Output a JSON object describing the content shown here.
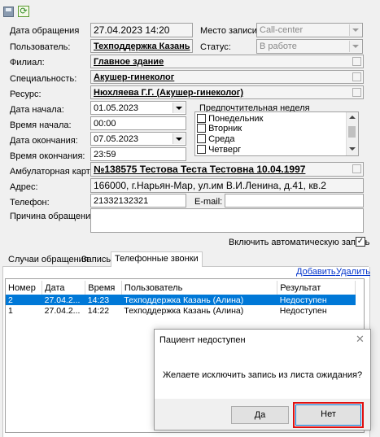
{
  "toolbar": {
    "save_icon": "save-icon",
    "refresh_icon": "refresh-icon"
  },
  "form": {
    "date_label": "Дата обращения",
    "date_value": "27.04.2023 14:20",
    "place_label": "Место записи:",
    "place_value": "Call-center",
    "user_label": "Пользователь:",
    "user_value": "Техподдержка Казань",
    "status_label": "Статус:",
    "status_value": "В работе",
    "branch_label": "Филиал:",
    "branch_value": "Главное здание",
    "spec_label": "Специальность:",
    "spec_value": "Акушер-гинеколог",
    "resource_label": "Ресурс:",
    "resource_value": "Нюхляева Г.Г. (Акушер-гинеколог)",
    "start_date_label": "Дата начала:",
    "start_date_value": "01.05.2023",
    "start_time_label": "Время начала:",
    "start_time_value": "00:00",
    "end_date_label": "Дата окончания:",
    "end_date_value": "07.05.2023",
    "end_time_label": "Время окончания:",
    "end_time_value": "23:59",
    "week_label": "Предпочтительная неделя",
    "weekdays": [
      "Понедельник",
      "Вторник",
      "Среда",
      "Четверг"
    ],
    "card_label": "Амбулаторная карта:",
    "card_value": "№138575 Тестова Теста Тестовна 10.04.1997",
    "address_label": "Адрес:",
    "address_value": "166000, г.Нарьян-Мар, ул.им В.И.Ленина, д.41, кв.2",
    "phone_label": "Телефон:",
    "phone_value": "21332132321",
    "email_label": "E-mail:",
    "email_value": "",
    "reason_label": "Причина обращения:",
    "reason_value": "",
    "auto_label": "Включить автоматическую запись"
  },
  "tabs": [
    "Случаи обращения",
    "Запись",
    "Телефонные звонки"
  ],
  "links": {
    "add": "Добавить",
    "delete": "Удалить"
  },
  "grid": {
    "columns": [
      "Номер",
      "Дата",
      "Время",
      "Пользователь",
      "Результат"
    ],
    "rows": [
      {
        "num": "2",
        "date": "27.04.2...",
        "time": "14:23",
        "user": "Техподдержка Казань (Алина)",
        "result": "Недоступен"
      },
      {
        "num": "1",
        "date": "27.04.2...",
        "time": "14:22",
        "user": "Техподдержка Казань (Алина)",
        "result": "Недоступен"
      }
    ]
  },
  "dialog": {
    "title": "Пациент недоступен",
    "message": "Желаете исключить запись из листа ожидания?",
    "yes": "Да",
    "no": "Нет"
  },
  "colors": {
    "selection": "#0078d7",
    "highlight": "#e01010"
  }
}
